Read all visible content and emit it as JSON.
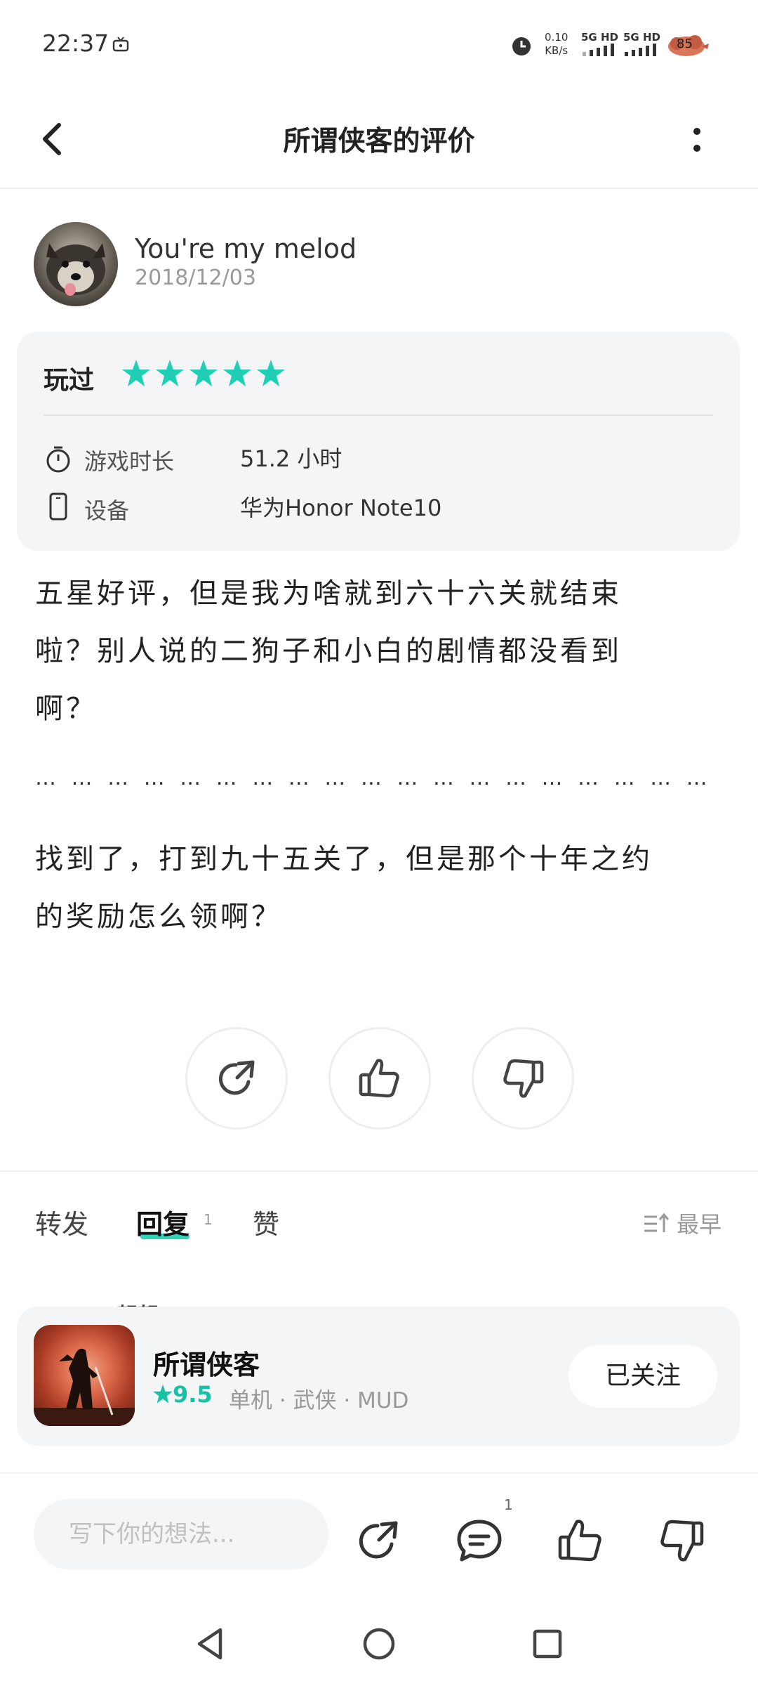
{
  "status_bar": {
    "time": "22:37",
    "net_speed": "0.10",
    "net_unit": "KB/s",
    "sig1": "5G HD",
    "sig2": "5G HD",
    "battery": "85"
  },
  "header": {
    "title": "所谓侠客的评价"
  },
  "author": {
    "name": "You're my melod",
    "date": "2018/12/03"
  },
  "played_card": {
    "label": "玩过",
    "stars": 5,
    "play_time_label": "游戏时长",
    "play_time_value": "51.2 小时",
    "device_label": "设备",
    "device_value": "华为Honor Note10"
  },
  "review": {
    "line1": "五星好评，但是我为啥就到六十六关就结束",
    "line2": "啦？别人说的二狗子和小白的剧情都没看到",
    "line3": "啊？",
    "dots": "… … … … … … … … … … … … … … … … … … …",
    "line4": "找到了，打到九十五关了，但是那个十年之约",
    "line5": "的奖励怎么领啊？"
  },
  "tabs": {
    "forward": "转发",
    "reply": "回复",
    "reply_count": "1",
    "like": "赞",
    "sort": "最早"
  },
  "comment_peek": "靓靓",
  "app_card": {
    "name": "所谓侠客",
    "rating": "9.5",
    "tags": "单机 · 武侠 · MUD",
    "follow_label": "已关注"
  },
  "bottom_bar": {
    "input_placeholder": "写下你的想法...",
    "comment_count": "1"
  },
  "colors": {
    "accent": "#2dd4b8",
    "star": "#1fcfb4",
    "rating": "#16c2a3"
  }
}
